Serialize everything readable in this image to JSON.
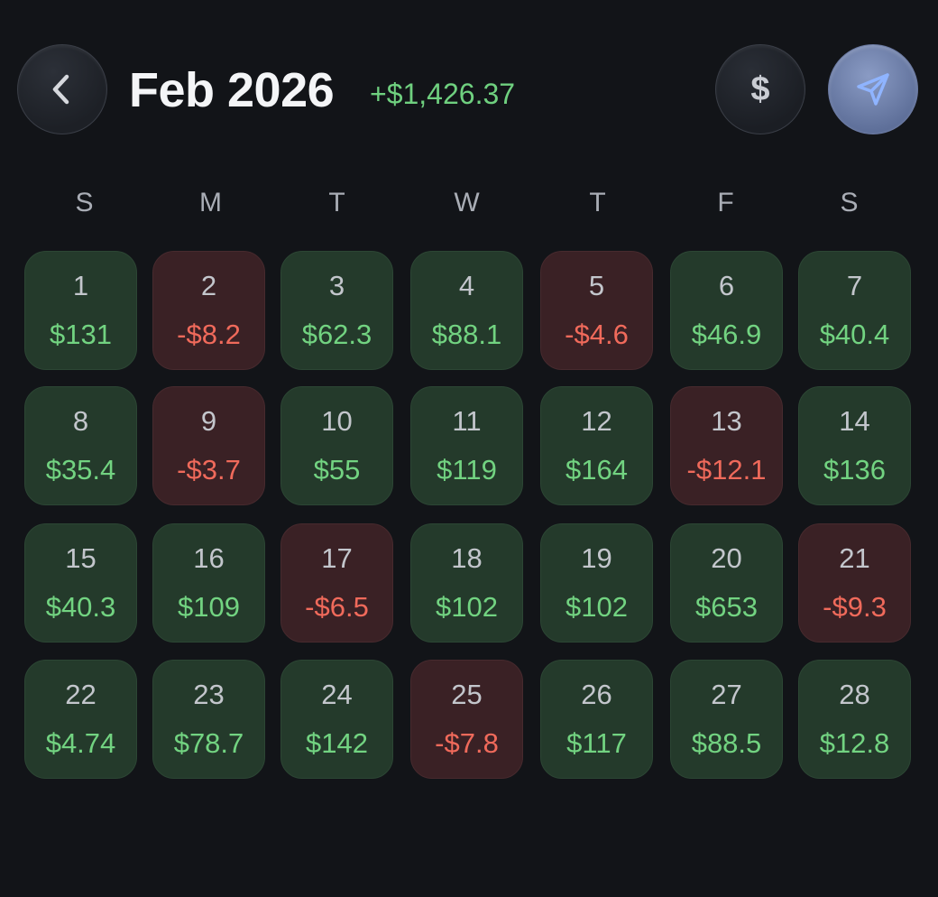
{
  "header": {
    "title": "Feb 2026",
    "total": "+$1,426.37",
    "currency_symbol": "$",
    "back_icon": "chevron-left-icon",
    "send_icon": "send-icon"
  },
  "colors": {
    "background": "#121418",
    "positive_cell": "#243a2b",
    "negative_cell": "#3a2125",
    "positive_text": "#72d381",
    "negative_text": "#f06a5b",
    "total_text": "#6fd07f",
    "send_button": "#6d7ea8"
  },
  "weekdays": [
    "S",
    "M",
    "T",
    "W",
    "T",
    "F",
    "S"
  ],
  "days": [
    {
      "day": "1",
      "amount": "$131",
      "type": "pos"
    },
    {
      "day": "2",
      "amount": "-$8.2",
      "type": "neg"
    },
    {
      "day": "3",
      "amount": "$62.3",
      "type": "pos"
    },
    {
      "day": "4",
      "amount": "$88.1",
      "type": "pos"
    },
    {
      "day": "5",
      "amount": "-$4.6",
      "type": "neg"
    },
    {
      "day": "6",
      "amount": "$46.9",
      "type": "pos"
    },
    {
      "day": "7",
      "amount": "$40.4",
      "type": "pos"
    },
    {
      "day": "8",
      "amount": "$35.4",
      "type": "pos"
    },
    {
      "day": "9",
      "amount": "-$3.7",
      "type": "neg"
    },
    {
      "day": "10",
      "amount": "$55",
      "type": "pos"
    },
    {
      "day": "11",
      "amount": "$119",
      "type": "pos"
    },
    {
      "day": "12",
      "amount": "$164",
      "type": "pos"
    },
    {
      "day": "13",
      "amount": "-$12.1",
      "type": "neg"
    },
    {
      "day": "14",
      "amount": "$136",
      "type": "pos"
    },
    {
      "day": "15",
      "amount": "$40.3",
      "type": "pos"
    },
    {
      "day": "16",
      "amount": "$109",
      "type": "pos"
    },
    {
      "day": "17",
      "amount": "-$6.5",
      "type": "neg"
    },
    {
      "day": "18",
      "amount": "$102",
      "type": "pos"
    },
    {
      "day": "19",
      "amount": "$102",
      "type": "pos"
    },
    {
      "day": "20",
      "amount": "$653",
      "type": "pos"
    },
    {
      "day": "21",
      "amount": "-$9.3",
      "type": "neg"
    },
    {
      "day": "22",
      "amount": "$4.74",
      "type": "pos"
    },
    {
      "day": "23",
      "amount": "$78.7",
      "type": "pos"
    },
    {
      "day": "24",
      "amount": "$142",
      "type": "pos"
    },
    {
      "day": "25",
      "amount": "-$7.8",
      "type": "neg"
    },
    {
      "day": "26",
      "amount": "$117",
      "type": "pos"
    },
    {
      "day": "27",
      "amount": "$88.5",
      "type": "pos"
    },
    {
      "day": "28",
      "amount": "$12.8",
      "type": "pos"
    }
  ]
}
